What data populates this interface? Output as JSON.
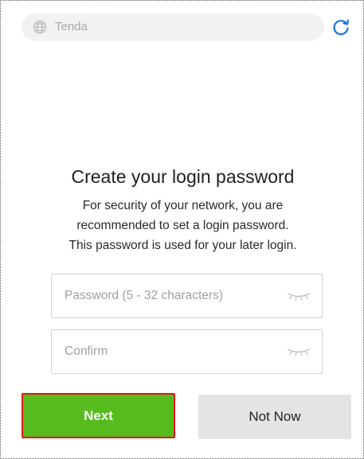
{
  "browser": {
    "url_text": "Tenda",
    "globe_icon": "globe-icon",
    "reload_icon": "reload-icon"
  },
  "setup": {
    "title": "Create your login password",
    "description_lines": [
      "For security of your network, you are",
      "recommended to set a login password.",
      "This password is used for your later login."
    ],
    "password_placeholder": "Password (5 - 32 characters)",
    "confirm_placeholder": "Confirm",
    "eye_icon": "eye-closed-icon",
    "next_label": "Next",
    "not_now_label": "Not Now"
  },
  "colors": {
    "primary_green": "#57bb1e",
    "highlight_red": "#e4161c",
    "secondary_gray": "#e4e4e4",
    "reload_blue": "#1a73e8"
  }
}
